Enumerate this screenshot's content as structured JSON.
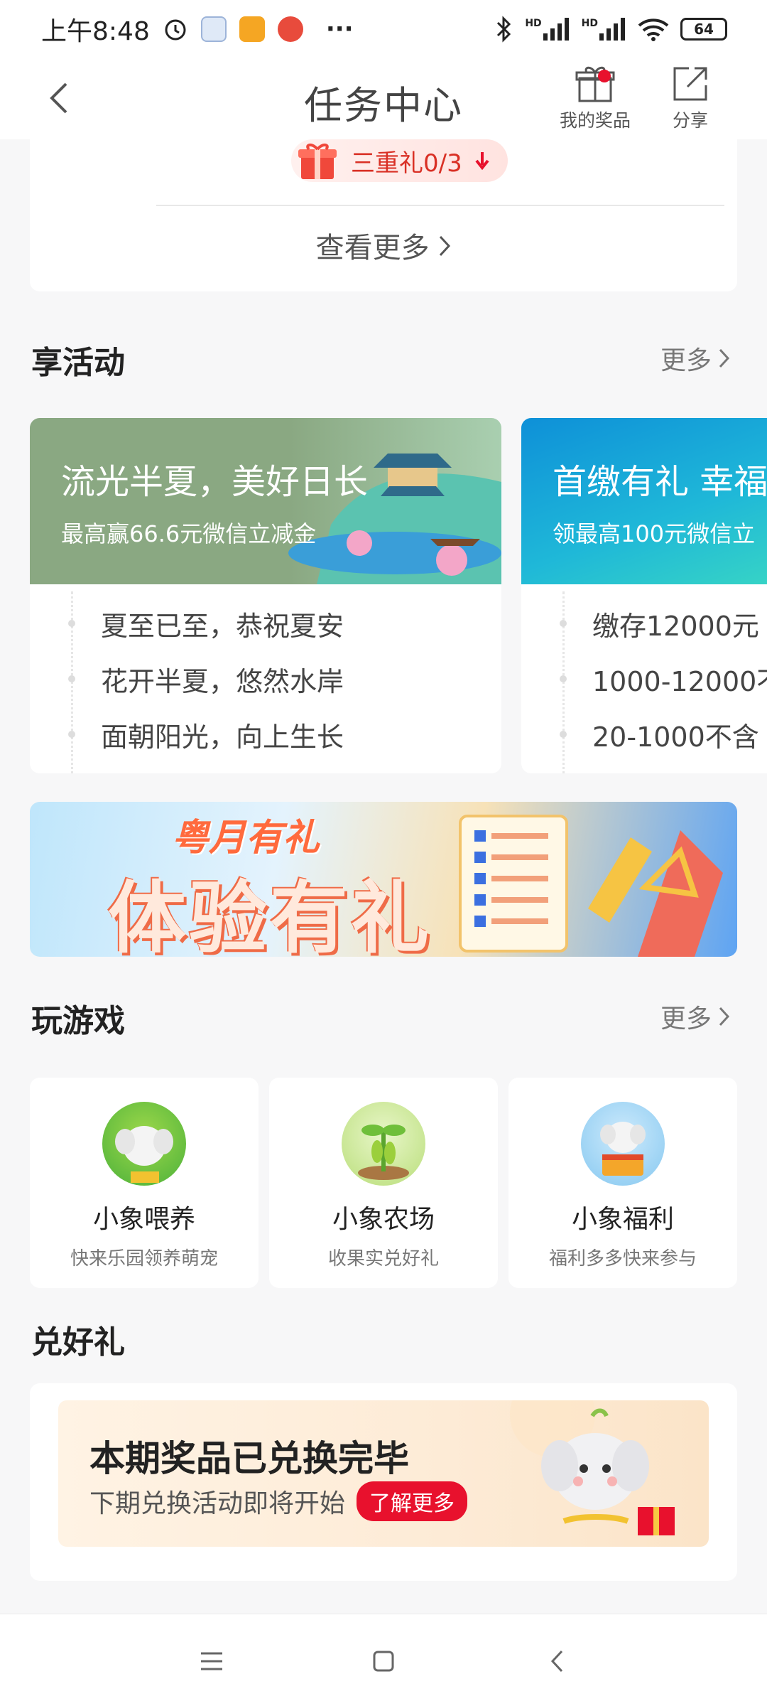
{
  "status_bar": {
    "time": "上午8:48",
    "signal_1": "HD",
    "signal_2": "HD",
    "battery": "64",
    "more": "···"
  },
  "header": {
    "title": "任务中心",
    "prizes_label": "我的奖品",
    "share_label": "分享"
  },
  "top_card": {
    "pill_label": "三重礼0/3",
    "view_more": "查看更多"
  },
  "activities": {
    "title": "享活动",
    "more": "更多",
    "cards": [
      {
        "title": "流光半夏，美好日长",
        "subtitle": "最高赢66.6元微信立减金",
        "items": [
          "夏至已至，恭祝夏安",
          "花开半夏，悠然水岸",
          "面朝阳光，向上生长"
        ]
      },
      {
        "title": "首缴有礼 幸福",
        "subtitle": "领最高100元微信立",
        "items": [
          "缴存12000元",
          "1000-12000不",
          "20-1000不含"
        ]
      }
    ]
  },
  "promo_banner": {
    "subtitle": "粤月有礼",
    "title": "体验有礼"
  },
  "games": {
    "title": "玩游戏",
    "more": "更多",
    "items": [
      {
        "name": "小象喂养",
        "desc": "快来乐园领养萌宠"
      },
      {
        "name": "小象农场",
        "desc": "收果实兑好礼"
      },
      {
        "name": "小象福利",
        "desc": "福利多多快来参与"
      }
    ]
  },
  "redeem": {
    "title": "兑好礼",
    "card_title": "本期奖品已兑换完毕",
    "card_sub": "下期兑换活动即将开始",
    "learn_more": "了解更多"
  },
  "colors": {
    "accent_red": "#e8112d",
    "banner1_green": "#8aa882",
    "banner2_teal": "#1fb8d8"
  }
}
